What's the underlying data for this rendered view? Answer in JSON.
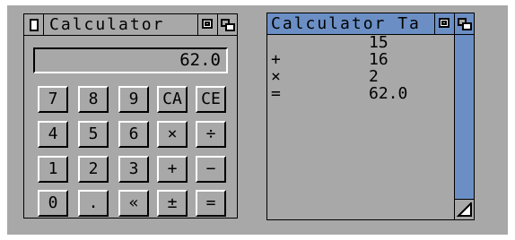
{
  "calculator": {
    "title": "Calculator",
    "display": "62.0",
    "buttons": [
      [
        "7",
        "8",
        "9",
        "CA",
        "CE"
      ],
      [
        "4",
        "5",
        "6",
        "×",
        "÷"
      ],
      [
        "1",
        "2",
        "3",
        "+",
        "−"
      ],
      [
        "0",
        ".",
        "«",
        "±",
        "="
      ]
    ]
  },
  "tape": {
    "title": "Calculator Ta",
    "rows": [
      {
        "op": "",
        "value": "15"
      },
      {
        "op": "+",
        "value": "16"
      },
      {
        "op": "×",
        "value": "2"
      },
      {
        "op": "=",
        "value": "62.0"
      }
    ]
  },
  "colors": {
    "background": "#a8a8a8",
    "active_title": "#6b8fc4",
    "scrollbar": "#6b8fc4"
  },
  "icons": [
    "close-icon",
    "zoom-icon",
    "depth-icon",
    "size-icon"
  ]
}
